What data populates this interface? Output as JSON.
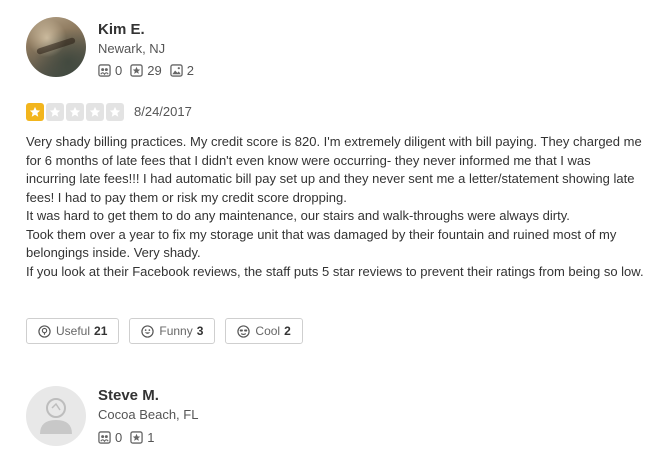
{
  "reviews": [
    {
      "user": {
        "name": "Kim E.",
        "location": "Newark, NJ",
        "friends": "0",
        "reviews": "29",
        "photos": "2"
      },
      "rating": 1,
      "max_rating": 5,
      "date": "8/24/2017",
      "paragraphs": [
        "Very shady billing practices. My credit score is 820. I'm extremely diligent with bill paying. They charged me for 6 months of late fees that I didn't even know were occurring- they never informed me that I was incurring late fees!!! I had automatic bill pay set up and they never sent me a letter/statement showing late fees! I had to pay them or risk my credit score dropping.",
        "It was hard to get them to do any maintenance, our stairs and walk-throughs were always dirty.",
        "Took them over a year to fix my storage unit that was damaged by their fountain and ruined most of my belongings inside. Very shady.",
        "If you look at their Facebook reviews, the staff puts 5 star reviews to prevent their ratings from being so low."
      ],
      "votes": {
        "useful_label": "Useful",
        "useful_count": "21",
        "funny_label": "Funny",
        "funny_count": "3",
        "cool_label": "Cool",
        "cool_count": "2"
      }
    },
    {
      "user": {
        "name": "Steve M.",
        "location": "Cocoa Beach, FL",
        "friends": "0",
        "reviews": "1"
      }
    }
  ],
  "colors": {
    "star_active": "#f2b51d",
    "star_inactive": "#e3e3e3"
  },
  "icons": {
    "friends": "friends-icon",
    "reviews": "review-star-icon",
    "photos": "photo-icon",
    "useful": "lightbulb-icon",
    "funny": "smiley-icon",
    "cool": "sunglasses-icon"
  }
}
